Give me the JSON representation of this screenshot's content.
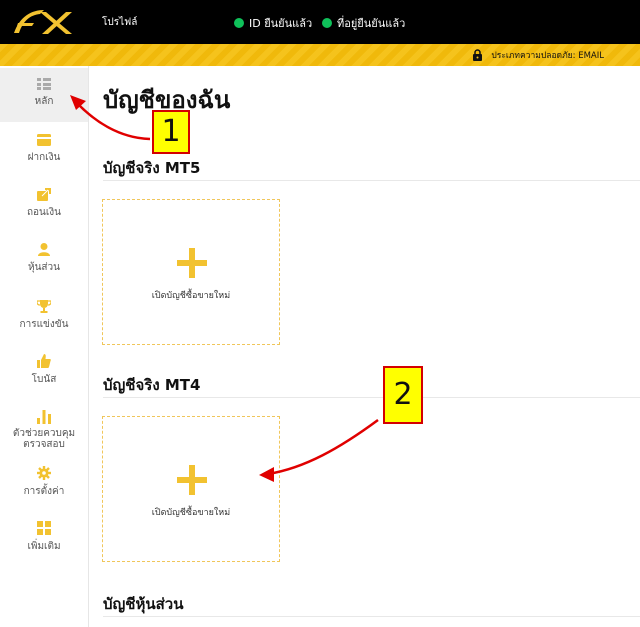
{
  "topbar": {
    "profile_label": "โปรไฟล์",
    "id_verified": "ID ยืนยันแล้ว",
    "address_verified": "ที่อยู่ยืนยันแล้ว",
    "verified_color": "#0fc15a"
  },
  "security": {
    "text": "ประเภทความปลอดภัย: EMAIL"
  },
  "sidebar": {
    "items": [
      {
        "label": "หลัก",
        "icon": "list-icon"
      },
      {
        "label": "ฝากเงิน",
        "icon": "card-icon"
      },
      {
        "label": "ถอนเงิน",
        "icon": "export-icon"
      },
      {
        "label": "หุ้นส่วน",
        "icon": "person-icon"
      },
      {
        "label": "การแข่งขัน",
        "icon": "trophy-icon"
      },
      {
        "label": "โบนัส",
        "icon": "thumbs-up-icon"
      },
      {
        "label": "ตัวช่วยควบคุม",
        "label2": "ตรวจสอบ",
        "icon": "bar-chart-icon"
      },
      {
        "label": "การตั้งค่า",
        "icon": "gear-icon"
      },
      {
        "label": "เพิ่มเติม",
        "icon": "grid-icon"
      }
    ],
    "accent": "#f2c230"
  },
  "main": {
    "title": "บัญชีของฉัน",
    "sections": [
      {
        "title": "บัญชีจริง MT5",
        "card_label": "เปิดบัญชีซื้อขายใหม่"
      },
      {
        "title": "บัญชีจริง MT4",
        "card_label": "เปิดบัญชีซื้อขายใหม่"
      },
      {
        "title": "บัญชีหุ้นส่วน"
      }
    ]
  },
  "annotations": {
    "badge1": "1",
    "badge2": "2",
    "arrow_color": "#e00000"
  }
}
